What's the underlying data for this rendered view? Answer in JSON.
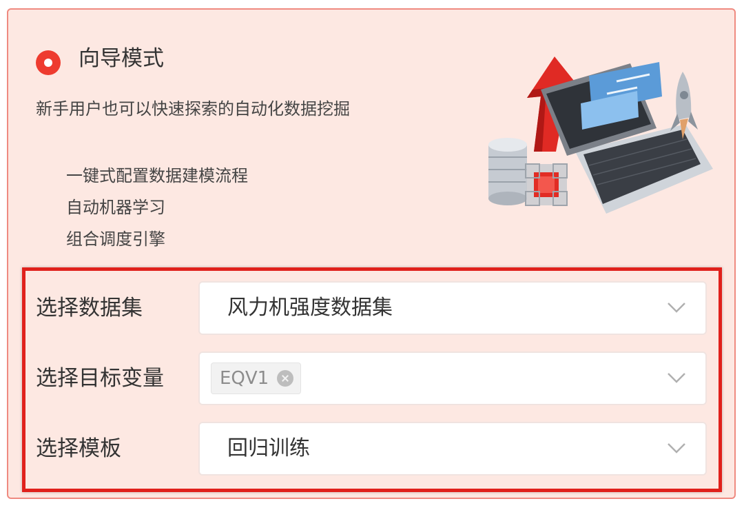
{
  "guide_mode": {
    "title": "向导模式",
    "description": "新手用户也可以快速探索的自动化数据挖掘",
    "features": [
      "一键式配置数据建模流程",
      "自动机器学习",
      "组合调度引擎"
    ],
    "selected": true
  },
  "form": {
    "dataset": {
      "label": "选择数据集",
      "value": "风力机强度数据集"
    },
    "target_variable": {
      "label": "选择目标变量",
      "tags": [
        "EQV1"
      ]
    },
    "template": {
      "label": "选择模板",
      "value": "回归训练"
    }
  },
  "colors": {
    "accent": "#ee3b2f",
    "card_background": "#fde8e2",
    "highlight_border": "#e0211c"
  },
  "icons": {
    "radio": "radio-selected-icon",
    "dropdown": "chevron-down-icon",
    "tag_remove": "close-circle-icon"
  }
}
